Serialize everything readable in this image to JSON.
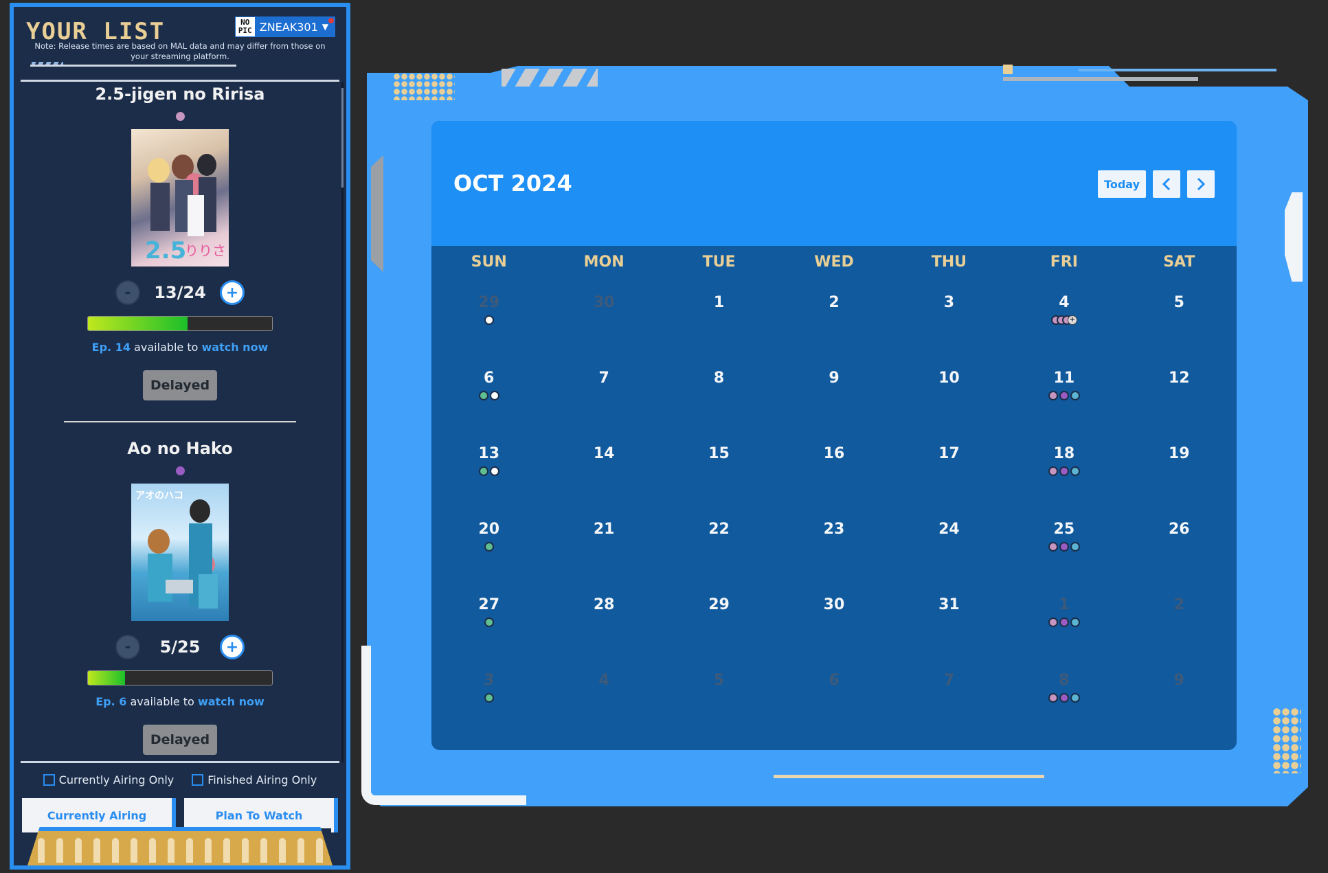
{
  "sidebar": {
    "title": "YOUR LIST",
    "user": {
      "avatar_text_top": "NO",
      "avatar_text_bottom": "PIC",
      "username": "ZNEAK301"
    },
    "note": "Note: Release times are based on MAL data and may differ from those on your streaming platform.",
    "cards": [
      {
        "title": "2.5-jigen no Ririsa",
        "status_color": "#c796c0",
        "poster_text": "2.5",
        "progress_text": "13/24",
        "progress_fraction": 0.54,
        "available_ep": "Ep. 14",
        "available_mid": " available to ",
        "available_action": "watch now",
        "delay_label": "Delayed"
      },
      {
        "title": "Ao no Hako",
        "status_color": "#9a5cc2",
        "poster_text": "アオのハコ",
        "progress_text": "5/25",
        "progress_fraction": 0.2,
        "available_ep": "Ep. 6",
        "available_mid": " available to ",
        "available_action": "watch now",
        "delay_label": "Delayed"
      }
    ],
    "filters": {
      "currently_airing_only": "Currently Airing Only",
      "finished_airing_only": "Finished Airing Only"
    },
    "tabs": {
      "currently_airing": "Currently Airing",
      "plan_to_watch": "Plan To Watch"
    }
  },
  "calendar": {
    "month_label": "OCT 2024",
    "today_label": "Today",
    "prev_icon": "chevron-left-icon",
    "next_icon": "chevron-right-icon",
    "weekdays": [
      "SUN",
      "MON",
      "TUE",
      "WED",
      "THU",
      "FRI",
      "SAT"
    ],
    "days": [
      {
        "d": "29",
        "other": true,
        "dots": [
          "white"
        ]
      },
      {
        "d": "30",
        "other": true,
        "dots": []
      },
      {
        "d": "1",
        "dots": []
      },
      {
        "d": "2",
        "dots": []
      },
      {
        "d": "3",
        "dots": []
      },
      {
        "d": "4",
        "dots": [
          "pink",
          "pink",
          "pink",
          "more"
        ],
        "overlap": true
      },
      {
        "d": "5",
        "dots": []
      },
      {
        "d": "6",
        "dots": [
          "green",
          "white"
        ]
      },
      {
        "d": "7",
        "dots": []
      },
      {
        "d": "8",
        "dots": []
      },
      {
        "d": "9",
        "dots": []
      },
      {
        "d": "10",
        "dots": []
      },
      {
        "d": "11",
        "dots": [
          "pink",
          "purple",
          "teal"
        ]
      },
      {
        "d": "12",
        "dots": []
      },
      {
        "d": "13",
        "dots": [
          "green",
          "white"
        ]
      },
      {
        "d": "14",
        "dots": []
      },
      {
        "d": "15",
        "dots": []
      },
      {
        "d": "16",
        "dots": []
      },
      {
        "d": "17",
        "dots": []
      },
      {
        "d": "18",
        "dots": [
          "pink",
          "purple",
          "teal"
        ]
      },
      {
        "d": "19",
        "dots": []
      },
      {
        "d": "20",
        "dots": [
          "green"
        ]
      },
      {
        "d": "21",
        "dots": []
      },
      {
        "d": "22",
        "dots": []
      },
      {
        "d": "23",
        "dots": []
      },
      {
        "d": "24",
        "dots": []
      },
      {
        "d": "25",
        "dots": [
          "pink",
          "purple",
          "teal"
        ]
      },
      {
        "d": "26",
        "dots": []
      },
      {
        "d": "27",
        "dots": [
          "green"
        ]
      },
      {
        "d": "28",
        "dots": []
      },
      {
        "d": "29",
        "dots": []
      },
      {
        "d": "30",
        "dots": []
      },
      {
        "d": "31",
        "dots": []
      },
      {
        "d": "1",
        "other": true,
        "dots": [
          "pink",
          "purple",
          "teal"
        ]
      },
      {
        "d": "2",
        "other": true,
        "dots": []
      },
      {
        "d": "3",
        "other": true,
        "dots": [
          "green"
        ]
      },
      {
        "d": "4",
        "other": true,
        "dots": []
      },
      {
        "d": "5",
        "other": true,
        "dots": []
      },
      {
        "d": "6",
        "other": true,
        "dots": []
      },
      {
        "d": "7",
        "other": true,
        "dots": []
      },
      {
        "d": "8",
        "other": true,
        "dots": [
          "pink",
          "purple",
          "teal"
        ]
      },
      {
        "d": "9",
        "other": true,
        "dots": []
      }
    ]
  },
  "colors": {
    "accent": "#2a8df0",
    "panel_bg": "#1c2d4a",
    "calendar_header": "#1e8ff5",
    "calendar_body": "#115a9e",
    "gold": "#e9cf95"
  }
}
